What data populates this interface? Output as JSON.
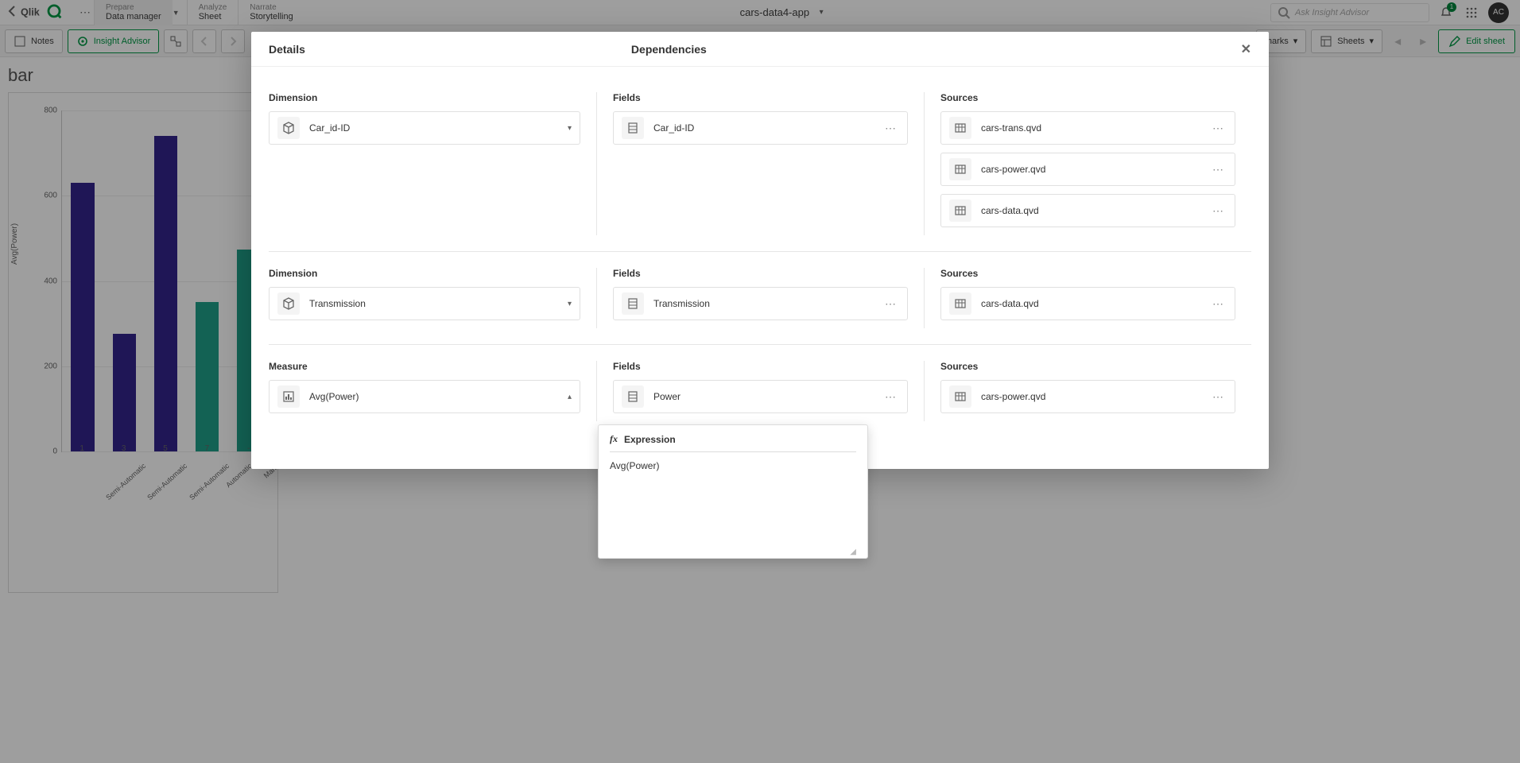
{
  "topbar": {
    "nav": [
      {
        "t1": "Prepare",
        "t2": "Data manager",
        "has_dd": true,
        "active": true
      },
      {
        "t1": "Analyze",
        "t2": "Sheet"
      },
      {
        "t1": "Narrate",
        "t2": "Storytelling"
      }
    ],
    "app_title": "cars-data4-app",
    "search_placeholder": "Ask Insight Advisor",
    "notif_count": "1",
    "avatar": "AC"
  },
  "toolbar2": {
    "notes": "Notes",
    "insight": "Insight Advisor",
    "bookmarks": "marks",
    "sheets": "Sheets",
    "edit": "Edit sheet"
  },
  "sheet": {
    "title": "bar"
  },
  "chart_data": {
    "type": "bar",
    "ylabel": "Avg(Power)",
    "ylim": [
      0,
      800
    ],
    "yticks": [
      0,
      200,
      400,
      600,
      800
    ],
    "x_numeric": [
      "1",
      "3",
      "5",
      "7",
      "-"
    ],
    "x_cat": [
      "Semi-Automatic",
      "Semi-Automatic",
      "Semi-Automatic",
      "Automatic",
      "Manu"
    ],
    "colors": [
      "#33258c",
      "#33258c",
      "#33258c",
      "#1f9e88",
      "#1f9e88"
    ],
    "values": [
      630,
      276,
      740,
      350,
      474
    ]
  },
  "modal": {
    "title": "Details",
    "deps_title": "Dependencies",
    "sections": [
      {
        "left_hdr": "Dimension",
        "left": {
          "label": "Car_id-ID",
          "kind": "dim",
          "tail": "chev-down"
        },
        "mid_hdr": "Fields",
        "mid": [
          {
            "label": "Car_id-ID",
            "kind": "field"
          }
        ],
        "right_hdr": "Sources",
        "right": [
          {
            "label": "cars-trans.qvd",
            "kind": "src"
          },
          {
            "label": "cars-power.qvd",
            "kind": "src"
          },
          {
            "label": "cars-data.qvd",
            "kind": "src"
          }
        ]
      },
      {
        "left_hdr": "Dimension",
        "left": {
          "label": "Transmission",
          "kind": "dim",
          "tail": "chev-down"
        },
        "mid_hdr": "Fields",
        "mid": [
          {
            "label": "Transmission",
            "kind": "field"
          }
        ],
        "right_hdr": "Sources",
        "right": [
          {
            "label": "cars-data.qvd",
            "kind": "src"
          }
        ]
      },
      {
        "left_hdr": "Measure",
        "left": {
          "label": "Avg(Power)",
          "kind": "meas",
          "tail": "chev-up"
        },
        "mid_hdr": "Fields",
        "mid": [
          {
            "label": "Power",
            "kind": "field"
          }
        ],
        "right_hdr": "Sources",
        "right": [
          {
            "label": "cars-power.qvd",
            "kind": "src"
          }
        ]
      }
    ],
    "expr_popover": {
      "title": "Expression",
      "body": "Avg(Power)"
    }
  }
}
